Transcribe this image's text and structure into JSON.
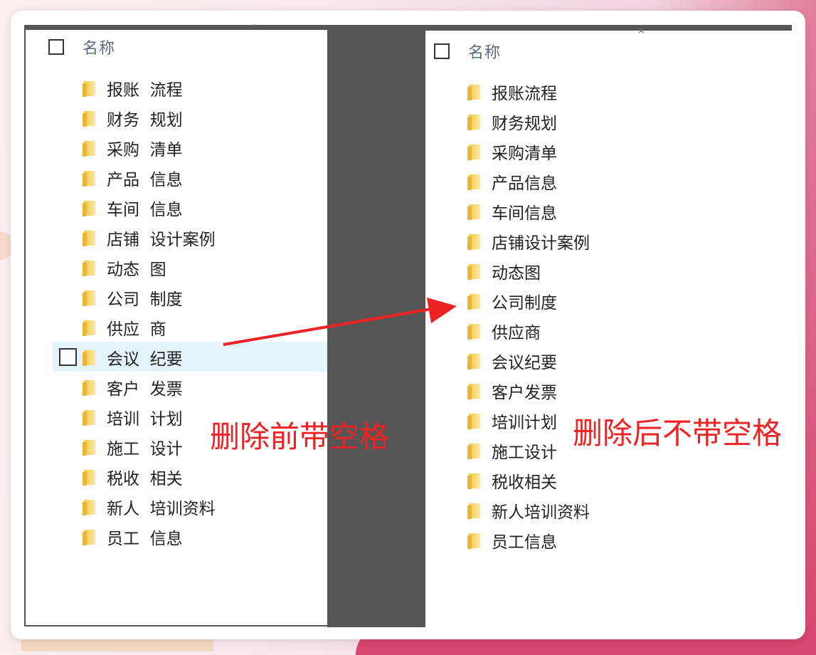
{
  "header": {
    "name_label": "名称"
  },
  "left_panel": {
    "items": [
      {
        "label": "报账  流程"
      },
      {
        "label": "财务  规划"
      },
      {
        "label": "采购  清单"
      },
      {
        "label": "产品  信息"
      },
      {
        "label": "车间  信息"
      },
      {
        "label": "店铺  设计案例"
      },
      {
        "label": "动态  图"
      },
      {
        "label": "公司  制度"
      },
      {
        "label": "供应  商"
      },
      {
        "label": "会议  纪要",
        "selected": true
      },
      {
        "label": "客户  发票"
      },
      {
        "label": "培训  计划"
      },
      {
        "label": "施工  设计"
      },
      {
        "label": "税收  相关"
      },
      {
        "label": "新人  培训资料"
      },
      {
        "label": "员工  信息"
      }
    ]
  },
  "right_panel": {
    "items": [
      {
        "label": "报账流程"
      },
      {
        "label": "财务规划"
      },
      {
        "label": "采购清单"
      },
      {
        "label": "产品信息"
      },
      {
        "label": "车间信息"
      },
      {
        "label": "店铺设计案例"
      },
      {
        "label": "动态图"
      },
      {
        "label": "公司制度"
      },
      {
        "label": "供应商"
      },
      {
        "label": "会议纪要"
      },
      {
        "label": "客户发票"
      },
      {
        "label": "培训计划"
      },
      {
        "label": "施工设计"
      },
      {
        "label": "税收相关"
      },
      {
        "label": "新人培训资料"
      },
      {
        "label": "员工信息"
      }
    ]
  },
  "annotations": {
    "before": "删除前带空格",
    "after": "删除后不带空格"
  },
  "colors": {
    "annotation": "#ee2222",
    "selection": "#e5f3fb",
    "folder": "#f5c542"
  }
}
